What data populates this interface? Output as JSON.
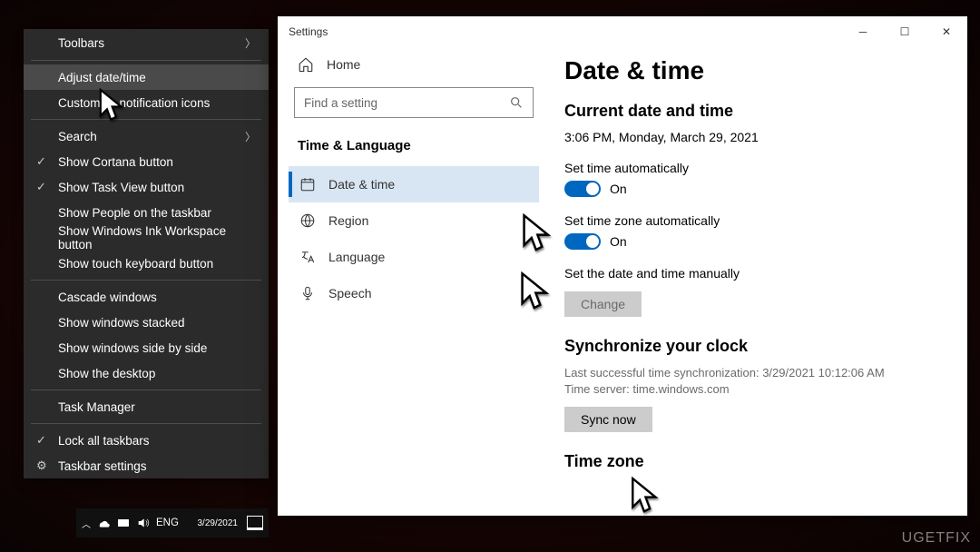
{
  "context_menu": {
    "toolbars": "Toolbars",
    "adjust_date_time": "Adjust date/time",
    "customize_icons": "Customize notification icons",
    "search": "Search",
    "show_cortana": "Show Cortana button",
    "show_task_view": "Show Task View button",
    "show_people": "Show People on the taskbar",
    "show_ink": "Show Windows Ink Workspace button",
    "show_touch_kb": "Show touch keyboard button",
    "cascade": "Cascade windows",
    "stacked": "Show windows stacked",
    "side_by_side": "Show windows side by side",
    "show_desktop": "Show the desktop",
    "task_manager": "Task Manager",
    "lock_taskbars": "Lock all taskbars",
    "taskbar_settings": "Taskbar settings"
  },
  "tray": {
    "lang": "ENG",
    "time": "",
    "date": "3/29/2021"
  },
  "settings": {
    "window_title": "Settings",
    "home": "Home",
    "search_placeholder": "Find a setting",
    "section": "Time & Language",
    "nav": {
      "date_time": "Date & time",
      "region": "Region",
      "language": "Language",
      "speech": "Speech"
    },
    "page": {
      "title": "Date & time",
      "current_heading": "Current date and time",
      "current_value": "3:06 PM, Monday, March 29, 2021",
      "set_time_auto": "Set time automatically",
      "on1": "On",
      "set_tz_auto": "Set time zone automatically",
      "on2": "On",
      "manual_heading": "Set the date and time manually",
      "change": "Change",
      "sync_heading": "Synchronize your clock",
      "sync_last": "Last successful time synchronization: 3/29/2021 10:12:06 AM",
      "sync_server": "Time server: time.windows.com",
      "sync_now": "Sync now",
      "timezone_heading": "Time zone"
    }
  },
  "watermark": "UGETFIX"
}
